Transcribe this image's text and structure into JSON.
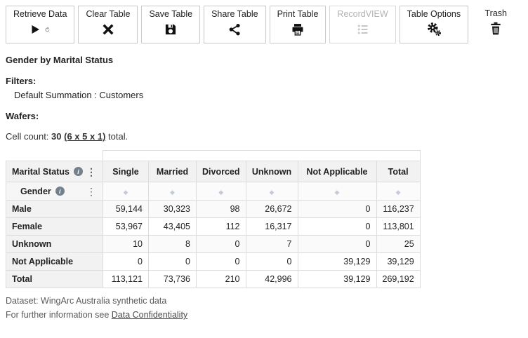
{
  "toolbar": {
    "buttons": [
      {
        "label": "Retrieve Data",
        "icon": "play-refresh-icon",
        "enabled": true
      },
      {
        "label": "Clear Table",
        "icon": "x-icon",
        "enabled": true
      },
      {
        "label": "Save Table",
        "icon": "save-icon",
        "enabled": true
      },
      {
        "label": "Share Table",
        "icon": "share-icon",
        "enabled": true
      },
      {
        "label": "Print Table",
        "icon": "printer-icon",
        "enabled": true
      },
      {
        "label": "RecordVIEW",
        "icon": "list-icon",
        "enabled": false
      },
      {
        "label": "Table Options",
        "icon": "gears-icon",
        "enabled": true
      }
    ],
    "trash_label": "Trash"
  },
  "page": {
    "title": "Gender by Marital Status",
    "filters_label": "Filters:",
    "filters_value": "Default Summation : Customers",
    "wafers_label": "Wafers:",
    "cell_count_label": "Cell count:",
    "cell_count_value": "30",
    "cell_count_link": "(6 x 5 x 1)",
    "cell_count_suffix": "total."
  },
  "icons": {
    "info": "i",
    "kebab": "⋮",
    "sort": "◆"
  },
  "table": {
    "row_dimension": "Marital Status",
    "col_dimension": "Gender",
    "columns": [
      "Single",
      "Married",
      "Divorced",
      "Unknown",
      "Not Applicable",
      "Total"
    ],
    "rows": [
      {
        "label": "Male",
        "values": [
          "59,144",
          "30,323",
          "98",
          "26,672",
          "0",
          "116,237"
        ]
      },
      {
        "label": "Female",
        "values": [
          "53,967",
          "43,405",
          "112",
          "16,317",
          "0",
          "113,801"
        ]
      },
      {
        "label": "Unknown",
        "values": [
          "10",
          "8",
          "0",
          "7",
          "0",
          "25"
        ]
      },
      {
        "label": "Not Applicable",
        "values": [
          "0",
          "0",
          "0",
          "0",
          "39,129",
          "39,129"
        ]
      },
      {
        "label": "Total",
        "values": [
          "113,121",
          "73,736",
          "210",
          "42,996",
          "39,129",
          "269,192"
        ]
      }
    ]
  },
  "footer": {
    "dataset": "Dataset: WingArc Australia synthetic data",
    "info_prefix": "For further information see",
    "info_link": "Data Confidentiality"
  }
}
